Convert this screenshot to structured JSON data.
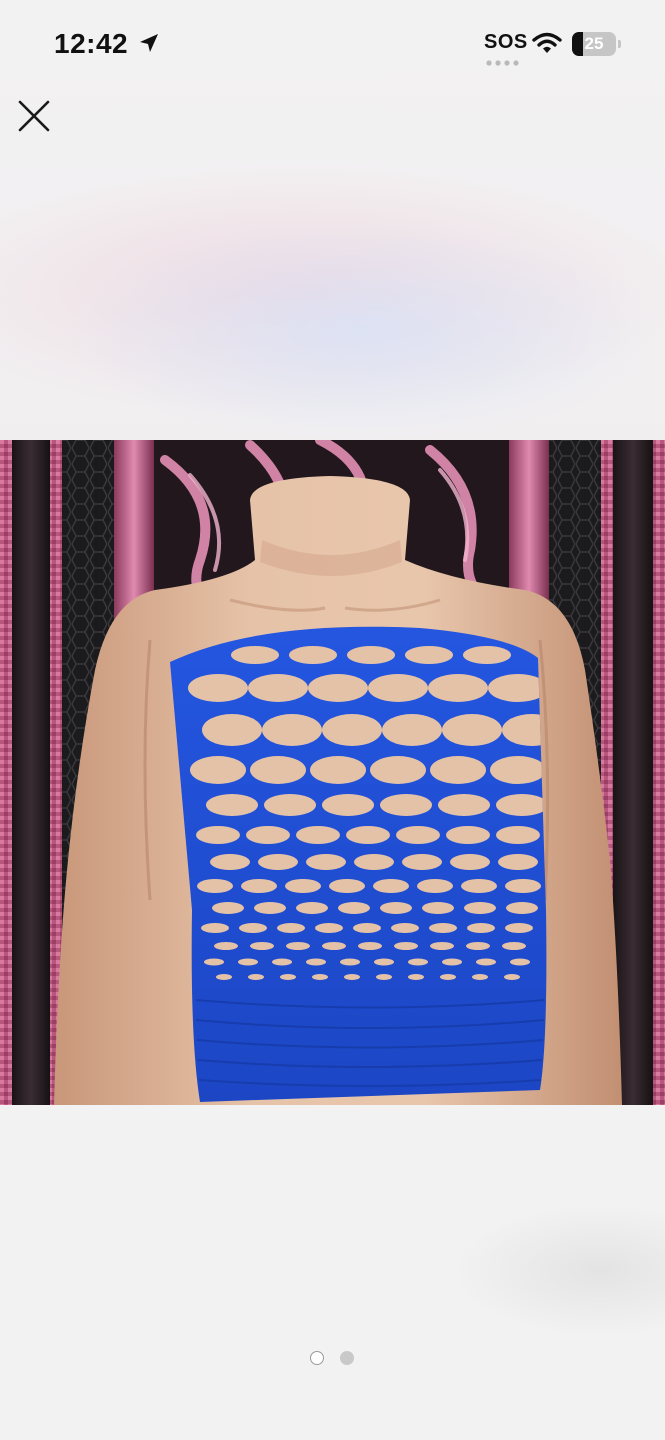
{
  "status_bar": {
    "time": "12:42",
    "location_icon": "location-arrow-icon",
    "carrier_text": "SOS",
    "wifi_icon": "wifi-icon",
    "battery_level": "25",
    "battery_fraction": 0.25
  },
  "header": {
    "close_icon": "close-icon"
  },
  "gallery": {
    "image_icon": "product-photo",
    "page_count": 2,
    "current_page": 1
  },
  "colors": {
    "garment_blue": "#1f4fd6",
    "mannequin_skin": "#e0b89a",
    "backdrop_pink": "#d47a9e"
  }
}
